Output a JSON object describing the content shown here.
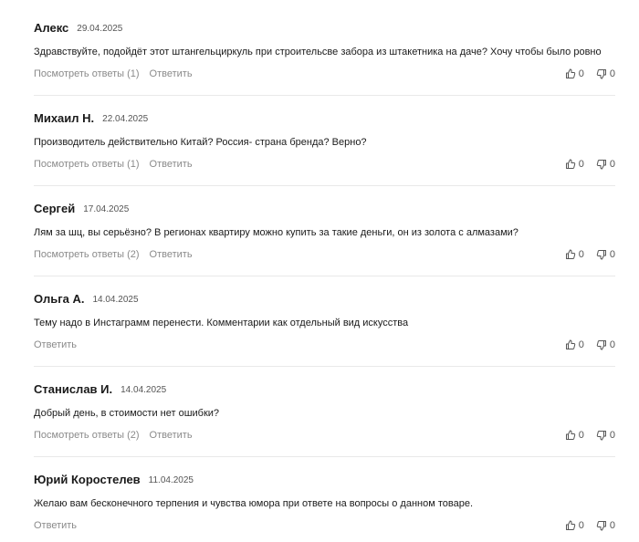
{
  "comments": [
    {
      "author": "Алекс",
      "date": "29.04.2025",
      "text": "Здравствуйте, подойдёт этот штангельциркуль при строительсве забора из штакетника на даче? Хочу чтобы было ровно",
      "replies_label": "Посмотреть ответы (1)",
      "reply_label": "Ответить",
      "likes": "0",
      "dislikes": "0"
    },
    {
      "author": "Михаил Н.",
      "date": "22.04.2025",
      "text": "Производитель действительно Китай? Россия- страна бренда? Верно?",
      "replies_label": "Посмотреть ответы (1)",
      "reply_label": "Ответить",
      "likes": "0",
      "dislikes": "0"
    },
    {
      "author": "Сергей",
      "date": "17.04.2025",
      "text": "Лям за шц, вы серьёзно? В регионах квартиру можно купить за такие деньги, он из золота с алмазами?",
      "replies_label": "Посмотреть ответы (2)",
      "reply_label": "Ответить",
      "likes": "0",
      "dislikes": "0"
    },
    {
      "author": "Ольга А.",
      "date": "14.04.2025",
      "text": "Тему надо в Инстаграмм перенести. Комментарии как отдельный вид искусства",
      "replies_label": "",
      "reply_label": "Ответить",
      "likes": "0",
      "dislikes": "0"
    },
    {
      "author": "Станислав И.",
      "date": "14.04.2025",
      "text": "Добрый день, в стоимости нет ошибки?",
      "replies_label": "Посмотреть ответы (2)",
      "reply_label": "Ответить",
      "likes": "0",
      "dislikes": "0"
    },
    {
      "author": "Юрий Коростелев",
      "date": "11.04.2025",
      "text": "Желаю вам бесконечного терпения и чувства юмора при ответе на вопросы о данном товаре.",
      "replies_label": "",
      "reply_label": "Ответить",
      "likes": "0",
      "dislikes": "0"
    }
  ],
  "icons": {
    "like": "thumbs-up-icon",
    "dislike": "thumbs-down-icon"
  },
  "colors": {
    "link": "#8a8a8a",
    "divider": "#e9e9e9",
    "text": "#1a1a1a"
  }
}
